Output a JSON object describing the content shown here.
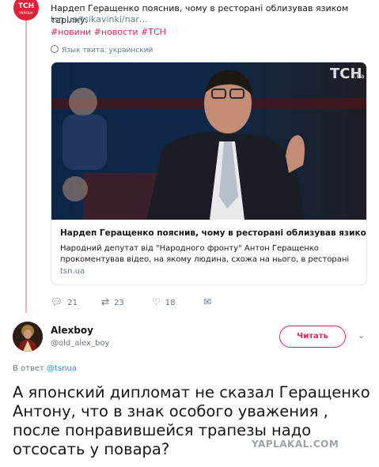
{
  "tweet": {
    "avatar_line1": "TCH",
    "avatar_line2": "УКРАЇНА",
    "text": "Нардеп Геращенко пояснив, чому в ресторані облизував язиком тарілку.",
    "link": "tsn.ua/tsikavinki/nar…",
    "tags": "#новини #новости #ТСН",
    "language": "Язык твита: украинский",
    "card": {
      "logo": "ТСН",
      "logo_suffix": ".ua",
      "title": "Нардеп Геращенко пояснив, чому в ресторані облизував язиком ...",
      "description": "Народний депутат від \"Народного фронту\" Антон Геращенко прокоментував відео, на якому людина, схожа на нього, в ресторані",
      "domain": "tsn.ua"
    },
    "actions": {
      "reply_count": "21",
      "retweet_count": "23",
      "like_count": "18"
    }
  },
  "reply": {
    "name": "Alexboy",
    "handle": "@old_alex_boy",
    "follow_label": "Читать",
    "reply_prefix": "В ответ",
    "reply_to": "@tsnua",
    "text": "А японский дипломат не сказал Геращенко Антону, что в знак особого уважения , после понравившейся трапезы надо отсосать у повара?"
  },
  "watermark": "YAPLAKAL.COM",
  "colors": {
    "link": "#1b95e0",
    "tag": "#e0245e",
    "follow_border": "#e0245e",
    "thread_line": "#e8b6bf"
  }
}
